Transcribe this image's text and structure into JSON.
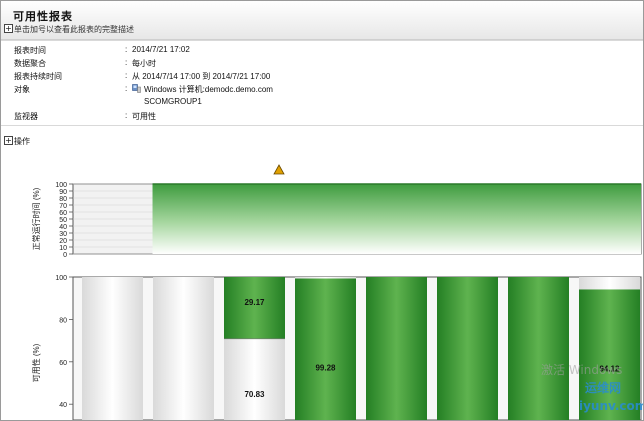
{
  "report": {
    "title": "可用性报表",
    "expand_hint": "单击加号以查看此报表的完整描述",
    "params": [
      {
        "label": "报表时间",
        "value": "2014/7/21 17:02"
      },
      {
        "label": "数据聚合",
        "value": "每小时"
      },
      {
        "label": "报表持续时间",
        "value": "从 2014/7/14 17:00 到 2014/7/21 17:00"
      },
      {
        "label": "对象",
        "value": "Windows 计算机:demodc.demo.com",
        "value2": "SCOMGROUP1"
      },
      {
        "label": "监视器",
        "value": "可用性"
      }
    ],
    "operations_label": "操作"
  },
  "colors": {
    "green_dark": "#2b8a2b",
    "green_light": "#6fbf5f",
    "unavailable_bg": "#e5e5e5",
    "warning": "#e0a000"
  },
  "chart_data": [
    {
      "type": "area",
      "ylabel": "正常运行时间 (%)",
      "ylim": [
        0,
        100
      ],
      "yticks": [
        0,
        10,
        20,
        30,
        40,
        50,
        60,
        70,
        80,
        90,
        100
      ],
      "segments": [
        {
          "from": 0.0,
          "to": 0.14,
          "value": null
        },
        {
          "from": 0.14,
          "to": 1.0,
          "value": 100
        }
      ],
      "marker": {
        "type": "warning-triangle"
      }
    },
    {
      "type": "bar",
      "ylabel": "可用性 (%)",
      "ylim": [
        0,
        100
      ],
      "yticks": [
        40,
        60,
        80,
        100
      ],
      "bars": [
        {
          "available": 0,
          "label": ""
        },
        {
          "available": 0,
          "label": ""
        },
        {
          "available": 29.17,
          "unavailable": 70.83,
          "label": "29.17",
          "label2": "70.83"
        },
        {
          "available": 99.28,
          "label": "99.28"
        },
        {
          "available": 100,
          "label": ""
        },
        {
          "available": 100,
          "label": ""
        },
        {
          "available": 100,
          "label": ""
        },
        {
          "available": 94.12,
          "label": "94.12"
        }
      ]
    }
  ],
  "watermark": {
    "text1": "激活 Windows",
    "text2": "运维网",
    "text3": "iyunv.com"
  }
}
